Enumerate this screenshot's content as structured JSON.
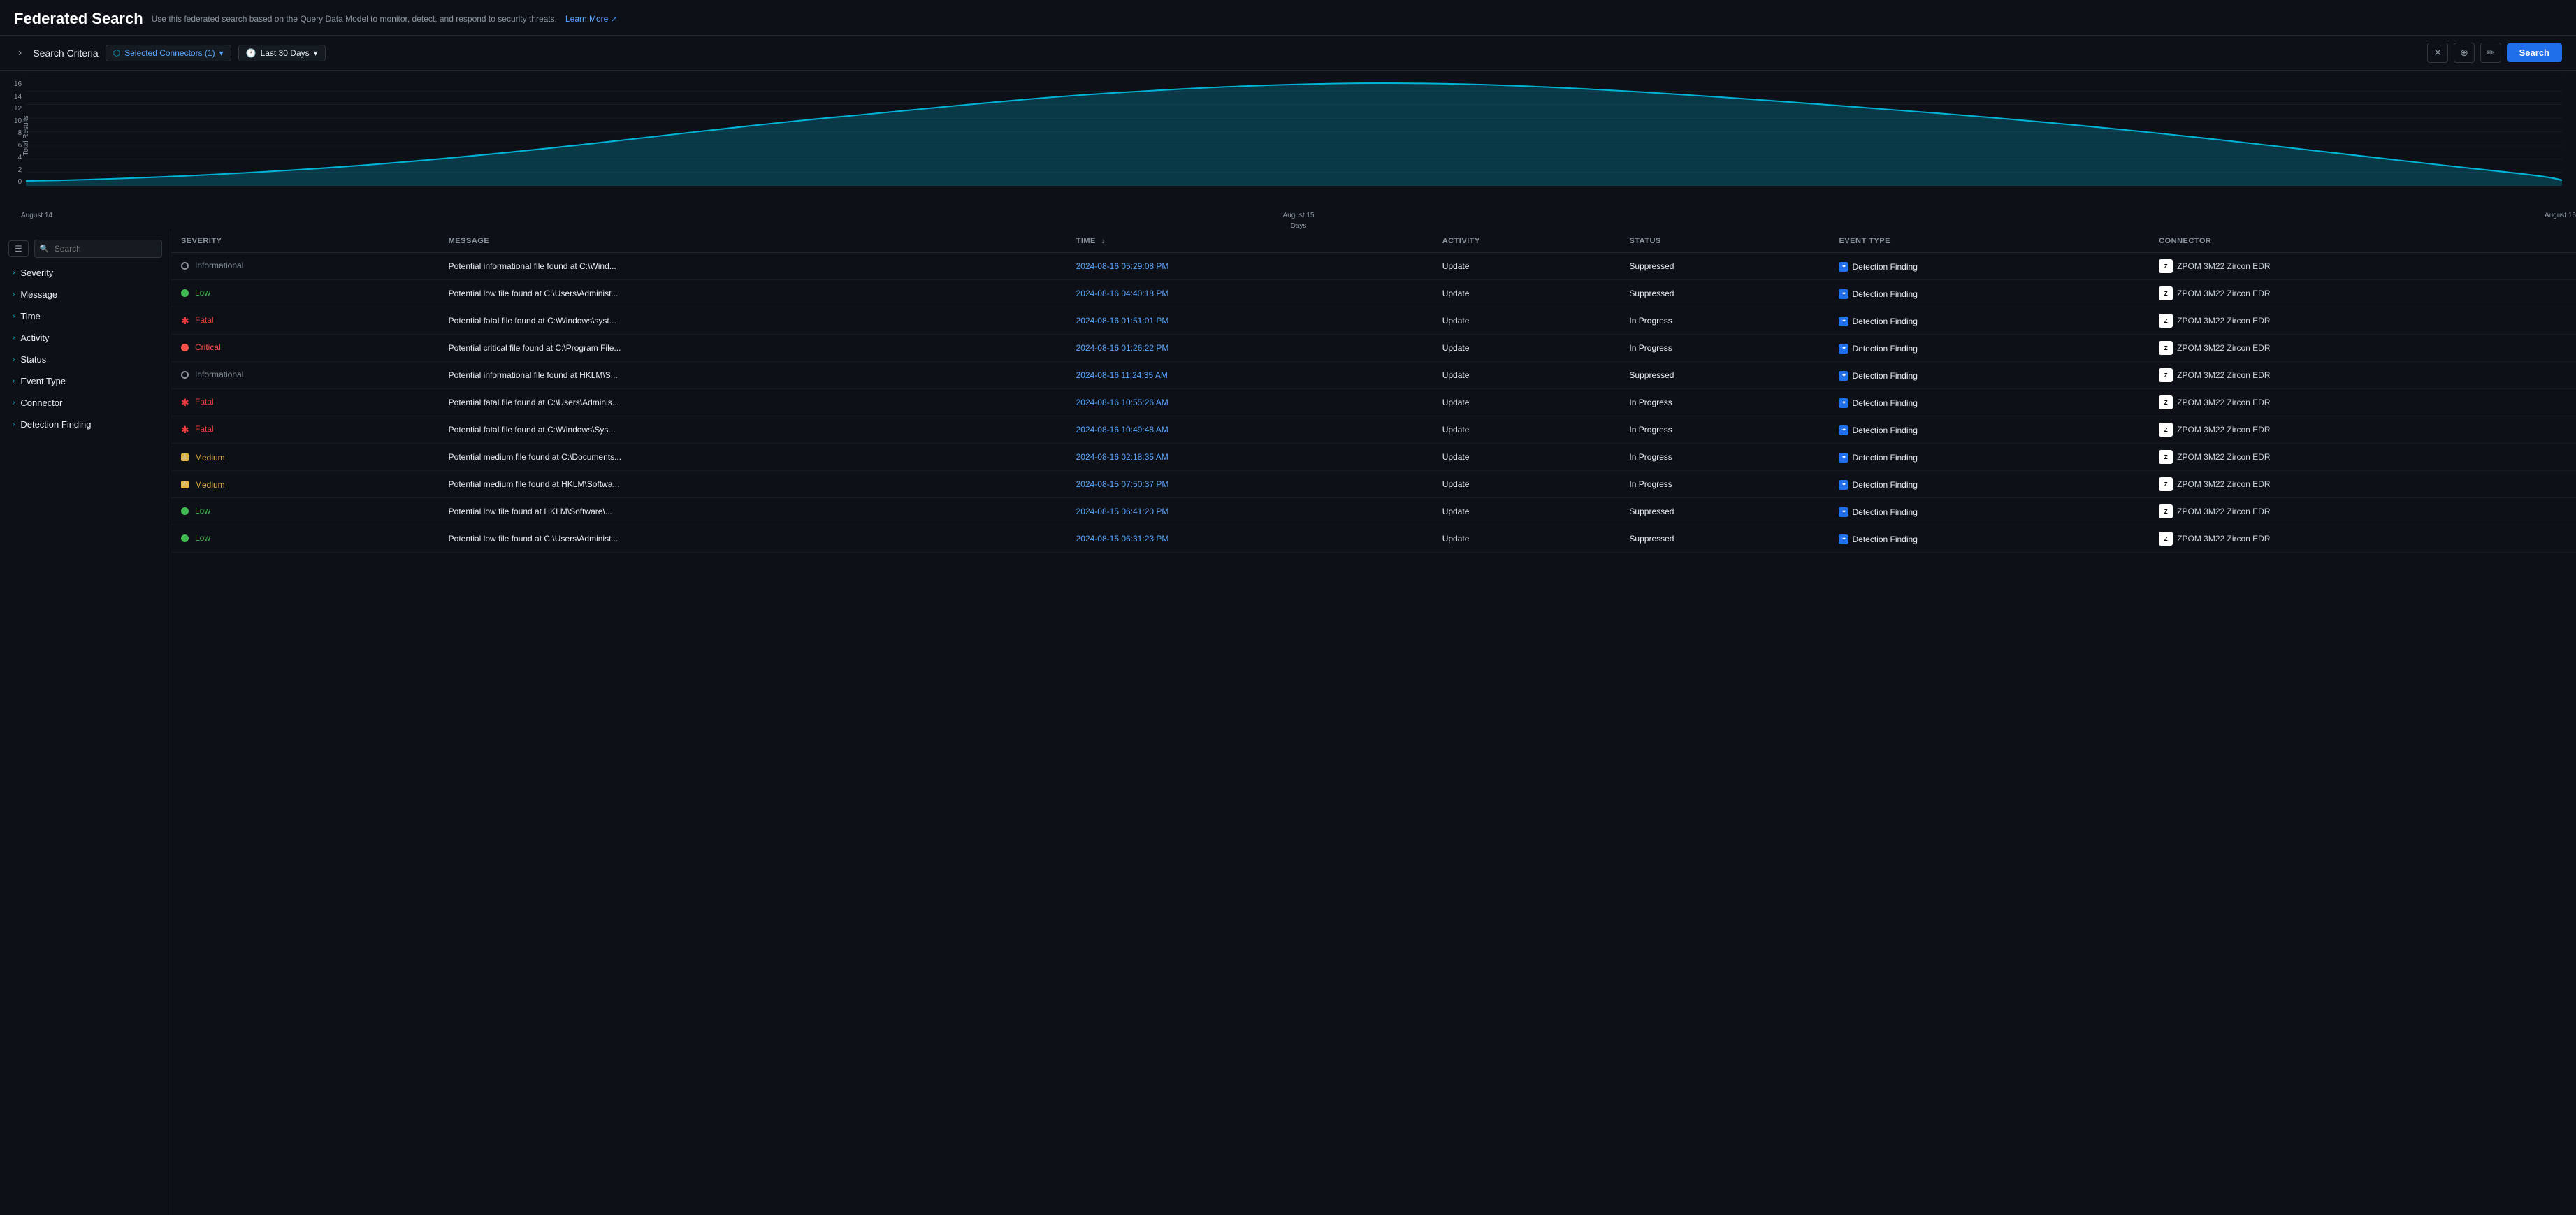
{
  "header": {
    "title": "Federated Search",
    "subtitle": "Use this federated search based on the Query Data Model to monitor, detect, and respond to security threats.",
    "learn_more": "Learn More"
  },
  "toolbar": {
    "expand_label": "›",
    "criteria_label": "Search Criteria",
    "connector_label": "Selected Connectors (1)",
    "time_label": "Last 30 Days",
    "search_label": "Search"
  },
  "chart": {
    "y_label": "Total Results",
    "y_ticks": [
      "0",
      "2",
      "4",
      "6",
      "8",
      "10",
      "12",
      "14",
      "16"
    ],
    "x_labels": [
      "August 14",
      "August 15",
      "August 16"
    ],
    "days_label": "Days"
  },
  "filter": {
    "search_placeholder": "Search",
    "items": [
      {
        "label": "Severity"
      },
      {
        "label": "Message"
      },
      {
        "label": "Time"
      },
      {
        "label": "Activity"
      },
      {
        "label": "Status"
      },
      {
        "label": "Event Type"
      },
      {
        "label": "Connector"
      },
      {
        "label": "Detection Finding"
      }
    ]
  },
  "table": {
    "columns": [
      {
        "label": "SEVERITY",
        "key": "severity"
      },
      {
        "label": "MESSAGE",
        "key": "message"
      },
      {
        "label": "TIME",
        "key": "time",
        "sortable": true
      },
      {
        "label": "ACTIVITY",
        "key": "activity"
      },
      {
        "label": "STATUS",
        "key": "status"
      },
      {
        "label": "EVENT TYPE",
        "key": "event_type"
      },
      {
        "label": "CONNECTOR",
        "key": "connector"
      }
    ],
    "rows": [
      {
        "severity": "Informational",
        "severity_class": "info",
        "message": "Potential informational file found at C:\\Wind...",
        "time": "2024-08-16 05:29:08 PM",
        "activity": "Update",
        "status": "Suppressed",
        "event_type": "Detection Finding",
        "connector": "ZPOM 3M22 Zircon EDR"
      },
      {
        "severity": "Low",
        "severity_class": "low",
        "message": "Potential low file found at C:\\Users\\Administ...",
        "time": "2024-08-16 04:40:18 PM",
        "activity": "Update",
        "status": "Suppressed",
        "event_type": "Detection Finding",
        "connector": "ZPOM 3M22 Zircon EDR"
      },
      {
        "severity": "Fatal",
        "severity_class": "fatal",
        "message": "Potential fatal file found at C:\\Windows\\syst...",
        "time": "2024-08-16 01:51:01 PM",
        "activity": "Update",
        "status": "In Progress",
        "event_type": "Detection Finding",
        "connector": "ZPOM 3M22 Zircon EDR"
      },
      {
        "severity": "Critical",
        "severity_class": "critical",
        "message": "Potential critical file found at C:\\Program File...",
        "time": "2024-08-16 01:26:22 PM",
        "activity": "Update",
        "status": "In Progress",
        "event_type": "Detection Finding",
        "connector": "ZPOM 3M22 Zircon EDR"
      },
      {
        "severity": "Informational",
        "severity_class": "info",
        "message": "Potential informational file found at HKLM\\S...",
        "time": "2024-08-16 11:24:35 AM",
        "activity": "Update",
        "status": "Suppressed",
        "event_type": "Detection Finding",
        "connector": "ZPOM 3M22 Zircon EDR"
      },
      {
        "severity": "Fatal",
        "severity_class": "fatal",
        "message": "Potential fatal file found at C:\\Users\\Adminis...",
        "time": "2024-08-16 10:55:26 AM",
        "activity": "Update",
        "status": "In Progress",
        "event_type": "Detection Finding",
        "connector": "ZPOM 3M22 Zircon EDR"
      },
      {
        "severity": "Fatal",
        "severity_class": "fatal",
        "message": "Potential fatal file found at C:\\Windows\\Sys...",
        "time": "2024-08-16 10:49:48 AM",
        "activity": "Update",
        "status": "In Progress",
        "event_type": "Detection Finding",
        "connector": "ZPOM 3M22 Zircon EDR"
      },
      {
        "severity": "Medium",
        "severity_class": "medium",
        "message": "Potential medium file found at C:\\Documents...",
        "time": "2024-08-16 02:18:35 AM",
        "activity": "Update",
        "status": "In Progress",
        "event_type": "Detection Finding",
        "connector": "ZPOM 3M22 Zircon EDR"
      },
      {
        "severity": "Medium",
        "severity_class": "medium",
        "message": "Potential medium file found at HKLM\\Softwa...",
        "time": "2024-08-15 07:50:37 PM",
        "activity": "Update",
        "status": "In Progress",
        "event_type": "Detection Finding",
        "connector": "ZPOM 3M22 Zircon EDR"
      },
      {
        "severity": "Low",
        "severity_class": "low",
        "message": "Potential low file found at HKLM\\Software\\...",
        "time": "2024-08-15 06:41:20 PM",
        "activity": "Update",
        "status": "Suppressed",
        "event_type": "Detection Finding",
        "connector": "ZPOM 3M22 Zircon EDR"
      },
      {
        "severity": "Low",
        "severity_class": "low",
        "message": "Potential low file found at C:\\Users\\Administ...",
        "time": "2024-08-15 06:31:23 PM",
        "activity": "Update",
        "status": "Suppressed",
        "event_type": "Detection Finding",
        "connector": "ZPOM 3M22 Zircon EDR"
      }
    ]
  }
}
